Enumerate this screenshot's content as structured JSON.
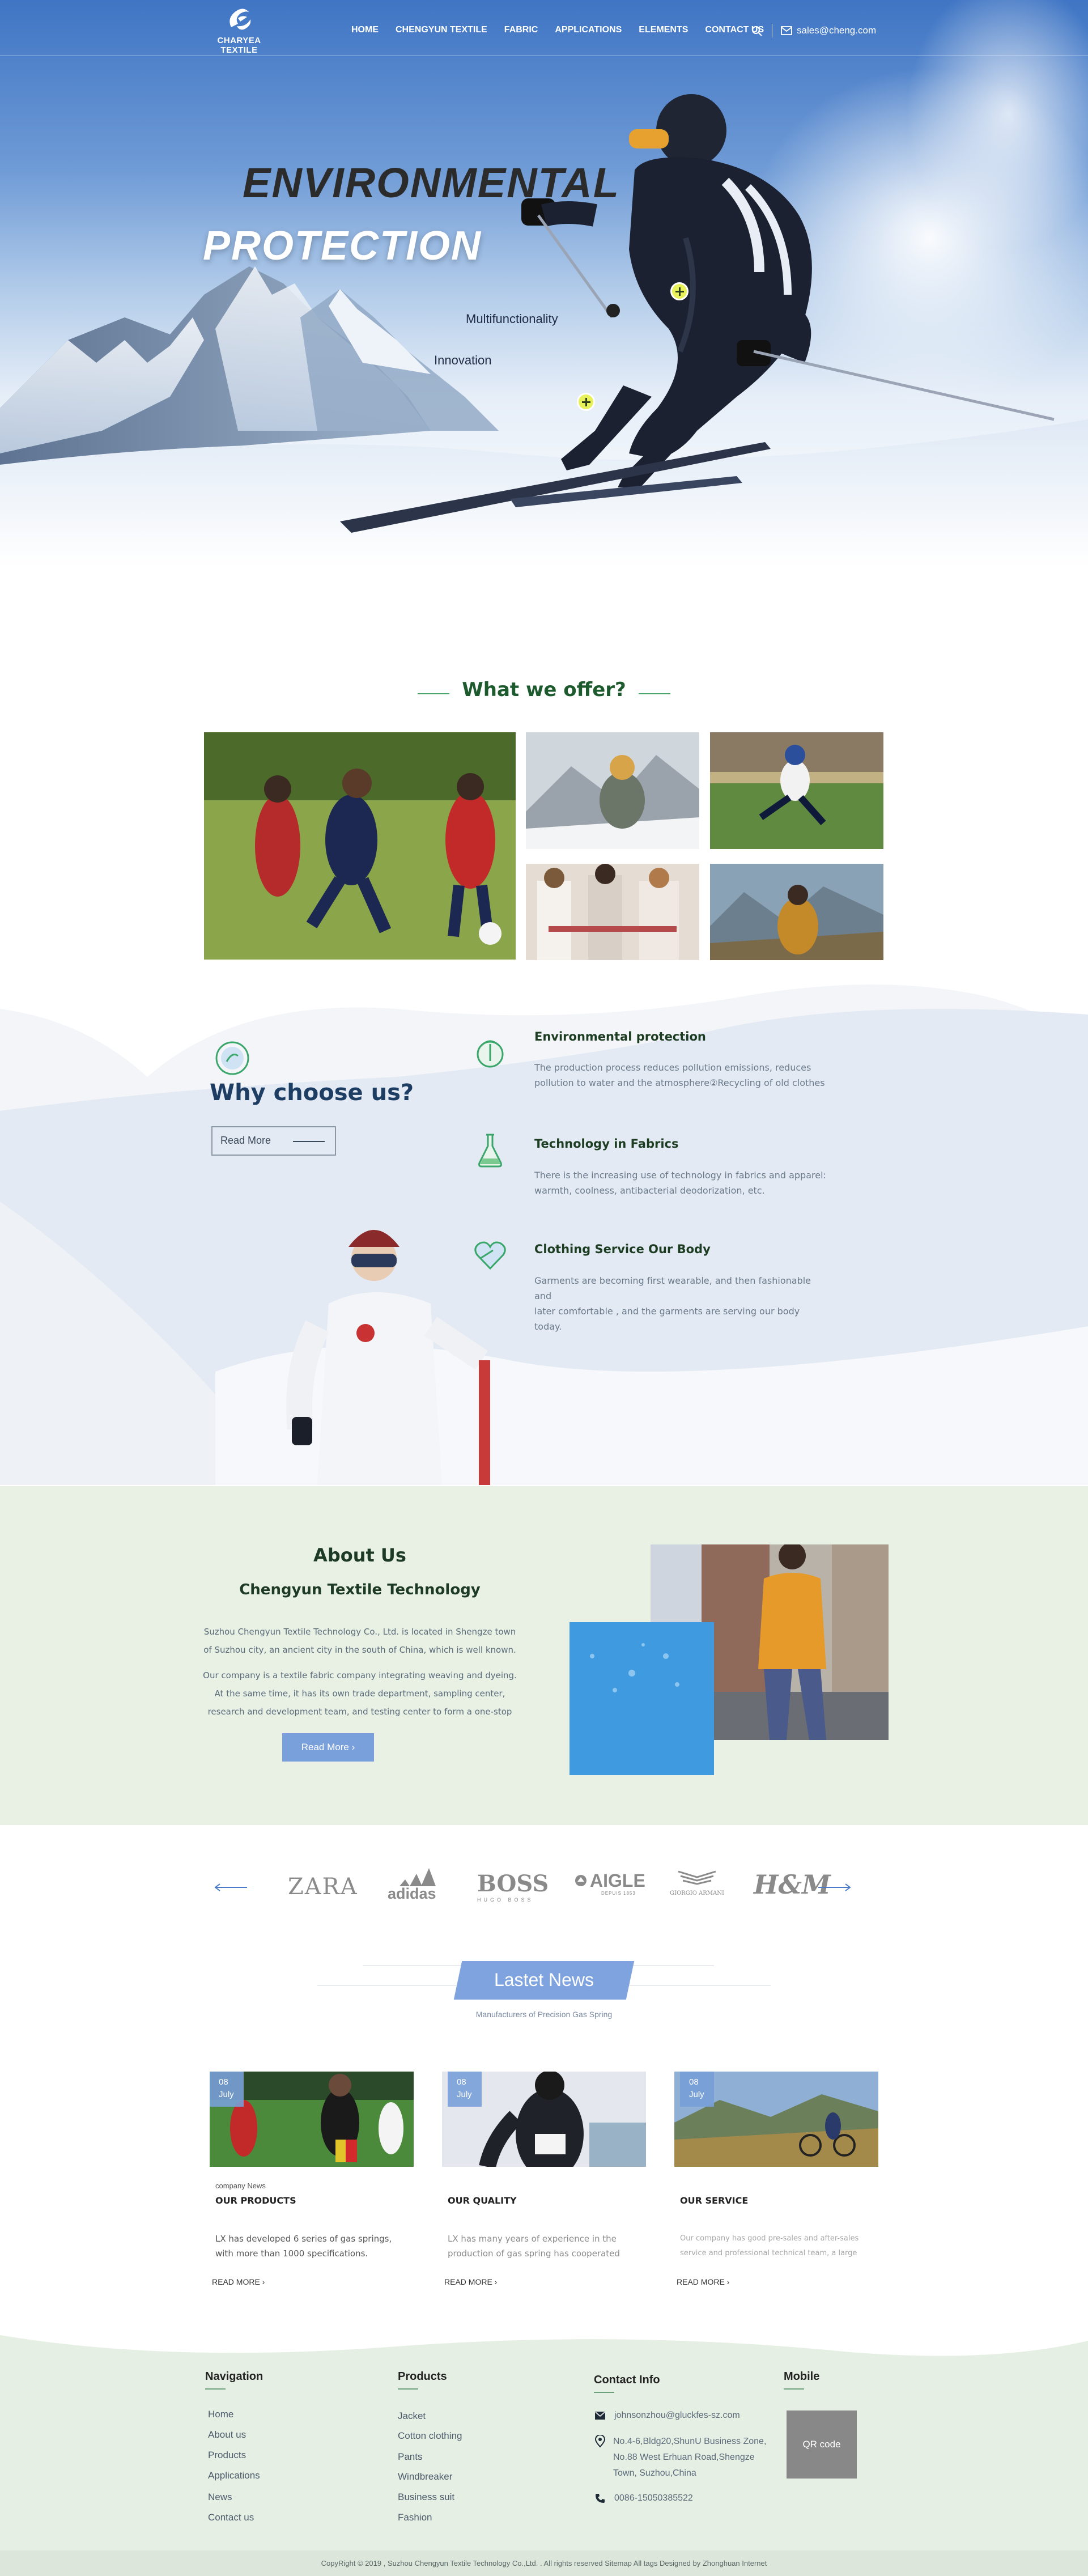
{
  "brand": {
    "logo_text": "CHARYEA TEXTILE"
  },
  "nav": {
    "items": [
      "HOME",
      "CHENGYUN TEXTILE",
      "FABRIC",
      "APPLICATIONS",
      "ELEMENTS",
      "CONTACT US"
    ],
    "email": "sales@cheng.com"
  },
  "hero": {
    "title_line1": "ENVIRONMENTAL",
    "title_line2": "PROTECTION",
    "tag1": "Multifunctionality",
    "tag2": "Innovation"
  },
  "offer": {
    "title": "What we offer?"
  },
  "why": {
    "title": "Why choose us?",
    "read_more": "Read More",
    "features": [
      {
        "title": "Environmental protection",
        "desc1": "The production process reduces pollution emissions, reduces",
        "desc2": "pollution to water and the atmosphere②Recycling of old clothes"
      },
      {
        "title": "Technology in Fabrics",
        "desc1": "There is the increasing use of technology in fabrics and apparel:",
        "desc2": "warmth, coolness, antibacterial deodorization, etc."
      },
      {
        "title": "Clothing Service Our Body",
        "desc1": "Garments are becoming first wearable, and then fashionable and",
        "desc2": "later  comfortable , and the garments are serving our body today."
      }
    ]
  },
  "about": {
    "title": "About Us",
    "subtitle": "Chengyun Textile Technology",
    "p1_l1": "Suzhou Chengyun Textile Technology Co., Ltd. is located in Shengze town",
    "p1_l2": "of Suzhou city, an ancient city in the south of China, which is well known.",
    "p2_l1": "Our company is a textile fabric company integrating weaving and dyeing.",
    "p2_l2": "At the same time, it has its own trade department, sampling center,",
    "p2_l3": "research and development team, and testing center to form a one-stop",
    "button": "Read More"
  },
  "brands": [
    "ZARA",
    "adidas",
    "BOSS",
    "AIGLE",
    "GIORGIO ARMANI",
    "H&M"
  ],
  "brands_sub": {
    "boss": "HUGO BOSS",
    "aigle": "DEPUIS 1853"
  },
  "news": {
    "title": "Lastet News",
    "subtitle": "Manufacturers of Precision Gas Spring",
    "cards": [
      {
        "day": "08",
        "month": "July",
        "tag": "company News",
        "title": "OUR PRODUCTS",
        "desc1": "LX has developed 6 series of gas springs,",
        "desc2": "with more than 1000 specifications.",
        "read": "READ MORE"
      },
      {
        "day": "08",
        "month": "July",
        "tag": "",
        "title": "OUR QUALITY",
        "desc1": "LX has many years of experience in the",
        "desc2": "production of gas spring has cooperated",
        "read": "READ MORE"
      },
      {
        "day": "08",
        "month": "July",
        "tag": "",
        "title": "OUR SERVICE",
        "desc1": "Our company has good pre-sales and after-sales",
        "desc2": "service and professional technical team, a large",
        "read": "READ MORE"
      }
    ]
  },
  "footer": {
    "nav_title": "Navigation",
    "nav_links": [
      "Home",
      "About us",
      "Products",
      "Applications",
      "News",
      "Contact us"
    ],
    "prod_title": "Products",
    "prod_links": [
      "Jacket",
      "Cotton clothing",
      "Pants",
      "Windbreaker",
      "Business suit",
      "Fashion"
    ],
    "contact_title": "Contact Info",
    "email": "johnsonzhou@gluckfes-sz.com",
    "addr1": "No.4-6,Bldg20,ShunU Business Zone,",
    "addr2": "No.88 West Erhuan Road,Shengze",
    "addr3": "Town, Suzhou,China",
    "phone": "0086-15050385522",
    "mobile_title": "Mobile",
    "qr": "QR code",
    "copyright": "CopyRight © 2019 ,  Suzhou Chengyun Textile Technology Co.,Ltd. . All rights reserved Sitemap  All tags  Designed by Zhonghuan Internet"
  },
  "colors": {
    "accent_blue": "#7fa3de",
    "green_dark": "#1d5b2f",
    "about_bg": "#e8f1e4",
    "footer_bg": "#e6efe3"
  }
}
